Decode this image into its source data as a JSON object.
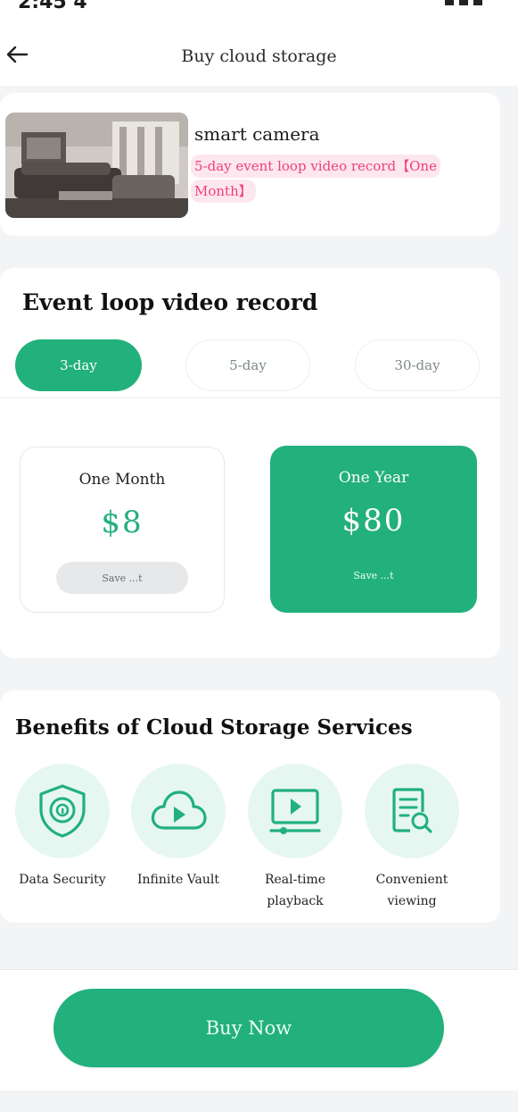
{
  "status_bar": {
    "time": "2:45 4"
  },
  "header": {
    "title": "Buy cloud storage"
  },
  "product": {
    "name": "smart camera",
    "description": "5-day event loop video record【One Month】"
  },
  "plan": {
    "section_title": "Event loop video record",
    "tabs": [
      {
        "label": "3-day",
        "active": true
      },
      {
        "label": "5-day",
        "active": false
      },
      {
        "label": "30-day",
        "active": false
      }
    ],
    "options": [
      {
        "period": "One Month",
        "price": "$8",
        "note": "Save ...t"
      },
      {
        "period": "One Year",
        "price": "$80",
        "note": "Save ...t"
      }
    ]
  },
  "benefits": {
    "title": "Benefits of Cloud Storage Services",
    "items": [
      {
        "label": "Data Security",
        "icon": "shield-lock-icon"
      },
      {
        "label": "Infinite Vault",
        "icon": "cloud-play-icon"
      },
      {
        "label": "Real-time playback",
        "icon": "video-playback-icon"
      },
      {
        "label": "Convenient viewing",
        "icon": "document-search-icon"
      }
    ]
  },
  "footer": {
    "buy_label": "Buy Now"
  },
  "colors": {
    "accent": "#22b07d",
    "accent_light": "#e6f7f1",
    "tag_text": "#ef3f78",
    "tag_bg": "#fde7ee"
  }
}
